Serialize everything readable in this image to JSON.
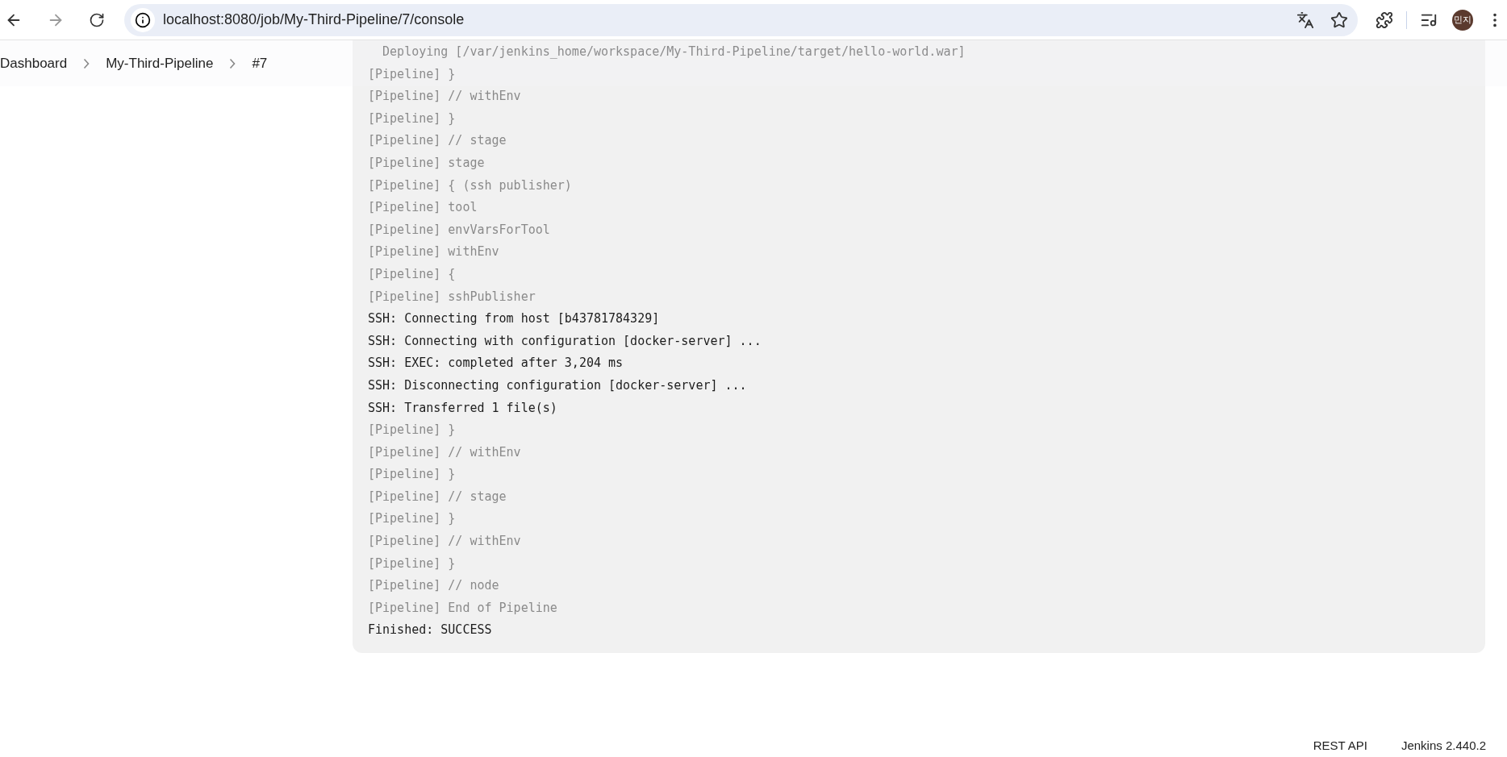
{
  "browser": {
    "url": "localhost:8080/job/My-Third-Pipeline/7/console",
    "profile": "민지"
  },
  "breadcrumbs": [
    "Dashboard",
    "My-Third-Pipeline",
    "#7"
  ],
  "console_lines": [
    {
      "text": "  Deploying [/var/jenkins_home/workspace/My-Third-Pipeline/target/hello-world.war]",
      "kind": "faded"
    },
    {
      "text": "[Pipeline] }",
      "kind": "faded"
    },
    {
      "text": "[Pipeline] // withEnv",
      "kind": "pipeline"
    },
    {
      "text": "[Pipeline] }",
      "kind": "pipeline"
    },
    {
      "text": "[Pipeline] // stage",
      "kind": "pipeline"
    },
    {
      "text": "[Pipeline] stage",
      "kind": "pipeline"
    },
    {
      "text": "[Pipeline] { (ssh publisher)",
      "kind": "pipeline"
    },
    {
      "text": "[Pipeline] tool",
      "kind": "pipeline"
    },
    {
      "text": "[Pipeline] envVarsForTool",
      "kind": "pipeline"
    },
    {
      "text": "[Pipeline] withEnv",
      "kind": "pipeline"
    },
    {
      "text": "[Pipeline] {",
      "kind": "pipeline"
    },
    {
      "text": "[Pipeline] sshPublisher",
      "kind": "pipeline"
    },
    {
      "text": "SSH: Connecting from host [b43781784329]",
      "kind": "output"
    },
    {
      "text": "SSH: Connecting with configuration [docker-server] ...",
      "kind": "output"
    },
    {
      "text": "SSH: EXEC: completed after 3,204 ms",
      "kind": "output"
    },
    {
      "text": "SSH: Disconnecting configuration [docker-server] ...",
      "kind": "output"
    },
    {
      "text": "SSH: Transferred 1 file(s)",
      "kind": "output"
    },
    {
      "text": "[Pipeline] }",
      "kind": "pipeline"
    },
    {
      "text": "[Pipeline] // withEnv",
      "kind": "pipeline"
    },
    {
      "text": "[Pipeline] }",
      "kind": "pipeline"
    },
    {
      "text": "[Pipeline] // stage",
      "kind": "pipeline"
    },
    {
      "text": "[Pipeline] }",
      "kind": "pipeline"
    },
    {
      "text": "[Pipeline] // withEnv",
      "kind": "pipeline"
    },
    {
      "text": "[Pipeline] }",
      "kind": "pipeline"
    },
    {
      "text": "[Pipeline] // node",
      "kind": "pipeline"
    },
    {
      "text": "[Pipeline] End of Pipeline",
      "kind": "pipeline"
    },
    {
      "text": "Finished: SUCCESS",
      "kind": "output"
    }
  ],
  "footer": [
    "REST API",
    "Jenkins 2.440.2"
  ]
}
